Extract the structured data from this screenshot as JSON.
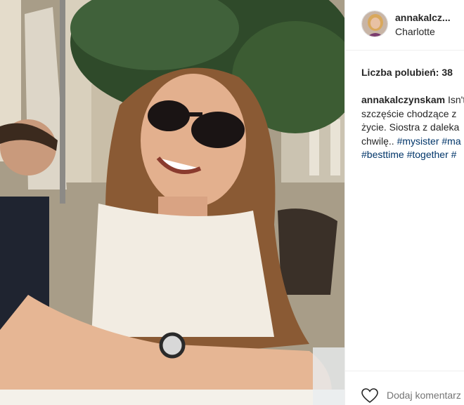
{
  "post": {
    "username": "annakalcz...",
    "location": "Charlotte",
    "likes_text": "Liczba polubień: 38",
    "caption": {
      "author": "annakalczynskam",
      "line1_text": " Isn't",
      "line2_text": "szczęście chodzące z",
      "line3_text": "życie. Siostra z daleka",
      "line4_text": "chwilę.. ",
      "line4_tags": [
        "#mysister",
        "#ma"
      ],
      "line5_tags": [
        "#besttime",
        "#together",
        "#"
      ]
    },
    "comment_placeholder": "Dodaj komentarz"
  },
  "icons": {
    "like": "heart-outline-icon"
  },
  "colors": {
    "hashtag": "#003569",
    "placeholder": "#999999",
    "divider": "#efefef"
  }
}
